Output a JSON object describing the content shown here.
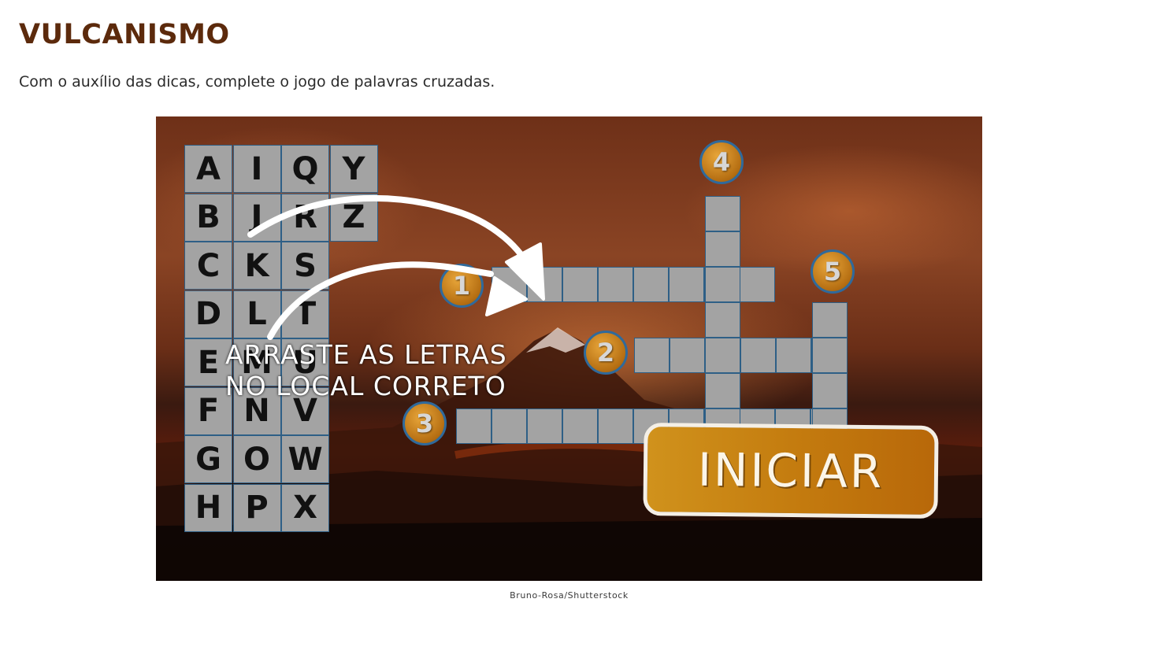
{
  "page": {
    "title": "VULCANISMO",
    "instruction": "Com o auxílio das dicas, complete o jogo de palavras cruzadas."
  },
  "game": {
    "keyboard": [
      [
        "A",
        "I",
        "Q",
        "Y"
      ],
      [
        "B",
        "J",
        "R",
        "Z"
      ],
      [
        "C",
        "K",
        "S"
      ],
      [
        "D",
        "L",
        "T"
      ],
      [
        "E",
        "M",
        "U"
      ],
      [
        "F",
        "N",
        "V"
      ],
      [
        "G",
        "O",
        "W"
      ],
      [
        "H",
        "P",
        "X"
      ]
    ],
    "hint_text": "ARRASTE AS LETRAS\nNO LOCAL CORRETO",
    "start_label": "INICIAR",
    "clues": {
      "clue_1": "1",
      "clue_2": "2",
      "clue_3": "3",
      "clue_4": "4",
      "clue_5": "5"
    },
    "answer_lengths": {
      "1": 8,
      "2": 6,
      "3": 11,
      "4": 7,
      "5": 4
    },
    "colors": {
      "cell": "#a3a3a3",
      "cell_border": "#2e5f86",
      "badge": "#c8841c",
      "start_button": "#c37a0e",
      "title": "#5c2a0c"
    }
  },
  "credit": "Bruno-Rosa/Shutterstock"
}
